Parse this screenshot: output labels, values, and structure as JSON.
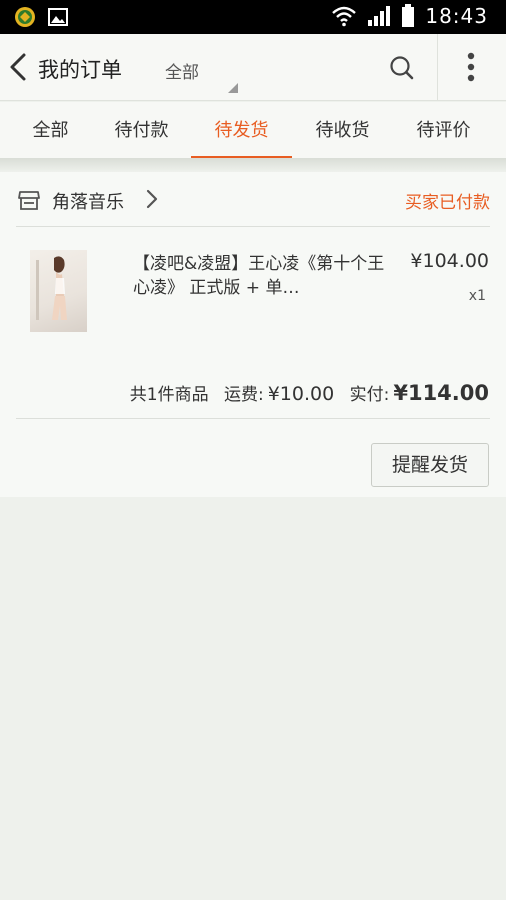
{
  "status_bar": {
    "time": "18:43",
    "icons": [
      "app-logo-icon",
      "image-icon",
      "wifi-icon",
      "signal-icon",
      "battery-icon"
    ]
  },
  "header": {
    "title": "我的订单",
    "filter_label": "全部",
    "icons": [
      "back-arrow-icon",
      "search-icon",
      "more-vertical-icon"
    ]
  },
  "tabs": [
    {
      "label": "全部",
      "active": false
    },
    {
      "label": "待付款",
      "active": false
    },
    {
      "label": "待发货",
      "active": true
    },
    {
      "label": "待收货",
      "active": false
    },
    {
      "label": "待评价",
      "active": false
    }
  ],
  "order": {
    "shop_name": "角落音乐",
    "status": "买家已付款",
    "item": {
      "title": "【凌吧&凌盟】王心凌《第十个王心凌》 正式版 + 单…",
      "price": "¥104.00",
      "quantity": "x1"
    },
    "summary": {
      "count_text": "共1件商品",
      "shipping_label": "运费:",
      "shipping_amount": "¥10.00",
      "paid_label": "实付:",
      "paid_amount": "¥114.00"
    },
    "remind_button": "提醒发货"
  },
  "colors": {
    "accent": "#e85d22",
    "background": "#eef1ec",
    "card": "#f7f9f6"
  }
}
